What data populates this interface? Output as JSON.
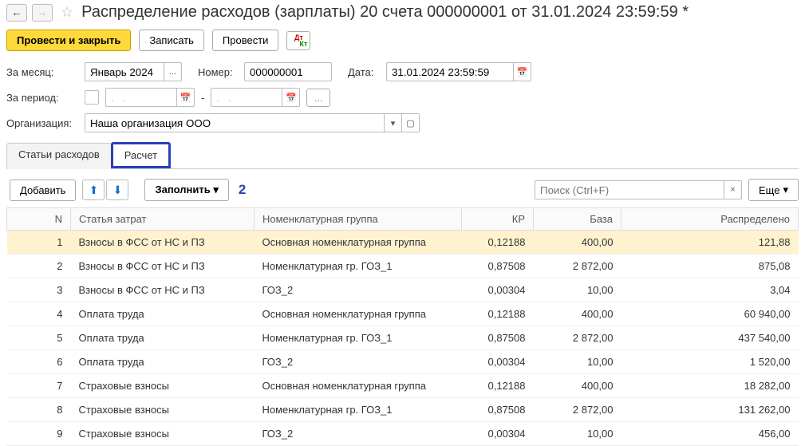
{
  "title": "Распределение расходов (зарплаты) 20 счета 000000001 от 31.01.2024 23:59:59 *",
  "cmd": {
    "post_close": "Провести и закрыть",
    "write": "Записать",
    "post": "Провести"
  },
  "fields": {
    "month_label": "За месяц:",
    "month_value": "Январь 2024",
    "number_label": "Номер:",
    "number_value": "000000001",
    "date_label": "Дата:",
    "date_value": "31.01.2024 23:59:59",
    "period_label": "За период:",
    "period_from": ".   .",
    "period_to": ".   .",
    "period_sep": "-",
    "org_label": "Организация:",
    "org_value": "Наша организация ООО"
  },
  "tabs": {
    "t1": "Статьи расходов",
    "t2": "Расчет"
  },
  "sub": {
    "add": "Добавить",
    "fill": "Заполнить",
    "annot": "2",
    "search_ph": "Поиск (Ctrl+F)",
    "more": "Еще",
    "ellipsis": "..."
  },
  "headers": {
    "n": "N",
    "item": "Статья затрат",
    "group": "Номенклатурная группа",
    "kr": "КР",
    "base": "База",
    "dist": "Распределено"
  },
  "rows": [
    {
      "n": "1",
      "item": "Взносы в ФСС от НС и ПЗ",
      "group": "Основная номенклатурная группа",
      "kr": "0,12188",
      "base": "400,00",
      "dist": "121,88"
    },
    {
      "n": "2",
      "item": "Взносы в ФСС от НС и ПЗ",
      "group": "Номенклатурная гр. ГОЗ_1",
      "kr": "0,87508",
      "base": "2 872,00",
      "dist": "875,08"
    },
    {
      "n": "3",
      "item": "Взносы в ФСС от НС и ПЗ",
      "group": "ГОЗ_2",
      "kr": "0,00304",
      "base": "10,00",
      "dist": "3,04"
    },
    {
      "n": "4",
      "item": "Оплата труда",
      "group": "Основная номенклатурная группа",
      "kr": "0,12188",
      "base": "400,00",
      "dist": "60 940,00"
    },
    {
      "n": "5",
      "item": "Оплата труда",
      "group": "Номенклатурная гр. ГОЗ_1",
      "kr": "0,87508",
      "base": "2 872,00",
      "dist": "437 540,00"
    },
    {
      "n": "6",
      "item": "Оплата труда",
      "group": "ГОЗ_2",
      "kr": "0,00304",
      "base": "10,00",
      "dist": "1 520,00"
    },
    {
      "n": "7",
      "item": "Страховые взносы",
      "group": "Основная номенклатурная группа",
      "kr": "0,12188",
      "base": "400,00",
      "dist": "18 282,00"
    },
    {
      "n": "8",
      "item": "Страховые взносы",
      "group": "Номенклатурная гр. ГОЗ_1",
      "kr": "0,87508",
      "base": "2 872,00",
      "dist": "131 262,00"
    },
    {
      "n": "9",
      "item": "Страховые взносы",
      "group": "ГОЗ_2",
      "kr": "0,00304",
      "base": "10,00",
      "dist": "456,00"
    }
  ]
}
